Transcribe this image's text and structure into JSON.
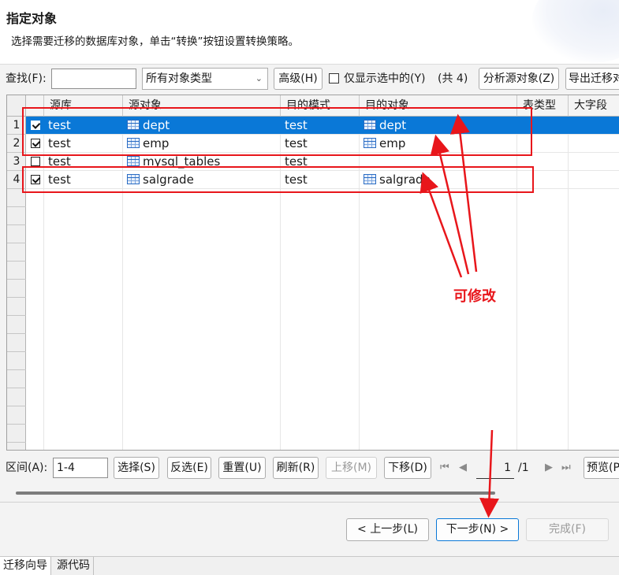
{
  "header": {
    "title": "指定对象",
    "description": "选择需要迁移的数据库对象，单击“转换”按钮设置转换策略。"
  },
  "toolbar": {
    "find_label": "查找(F):",
    "find_value": "",
    "type_select": "所有对象类型",
    "advanced_button": "高级(H)",
    "only_selected_label": "仅显示选中的(Y)",
    "count_text": "(共 4)",
    "analyze_button": "分析源对象(Z)",
    "export_button": "导出迁移对"
  },
  "grid": {
    "columns": [
      "源库",
      "源对象",
      "目的模式",
      "目的对象",
      "表类型",
      "大字段"
    ],
    "rows": [
      {
        "num": "1",
        "checked": true,
        "src_db": "test",
        "src_obj": "dept",
        "dst_schema": "test",
        "dst_obj": "dept"
      },
      {
        "num": "2",
        "checked": true,
        "src_db": "test",
        "src_obj": "emp",
        "dst_schema": "test",
        "dst_obj": "emp"
      },
      {
        "num": "3",
        "checked": false,
        "src_db": "test",
        "src_obj": "mysql_tables",
        "dst_schema": "test",
        "dst_obj": ""
      },
      {
        "num": "4",
        "checked": true,
        "src_db": "test",
        "src_obj": "salgrade",
        "dst_schema": "test",
        "dst_obj": "salgrade"
      }
    ]
  },
  "bottombar": {
    "range_label": "区间(A):",
    "range_value": "1-4",
    "select_button": "选择(S)",
    "invert_button": "反选(E)",
    "reset_button": "重置(U)",
    "refresh_button": "刷新(R)",
    "move_up_button": "上移(M)",
    "move_down_button": "下移(D)",
    "page_value": "1",
    "page_total": "/1",
    "preview_button": "预览(P"
  },
  "footer": {
    "prev_button": "< 上一步(L)",
    "next_button": "下一步(N) >",
    "finish_button": "完成(F)"
  },
  "tabs": [
    "迁移向导",
    "源代码"
  ],
  "annotation": {
    "text": "可修改",
    "color": "#e8161b"
  },
  "colors": {
    "selection": "#0a78d7",
    "annotation": "#e8161b"
  }
}
